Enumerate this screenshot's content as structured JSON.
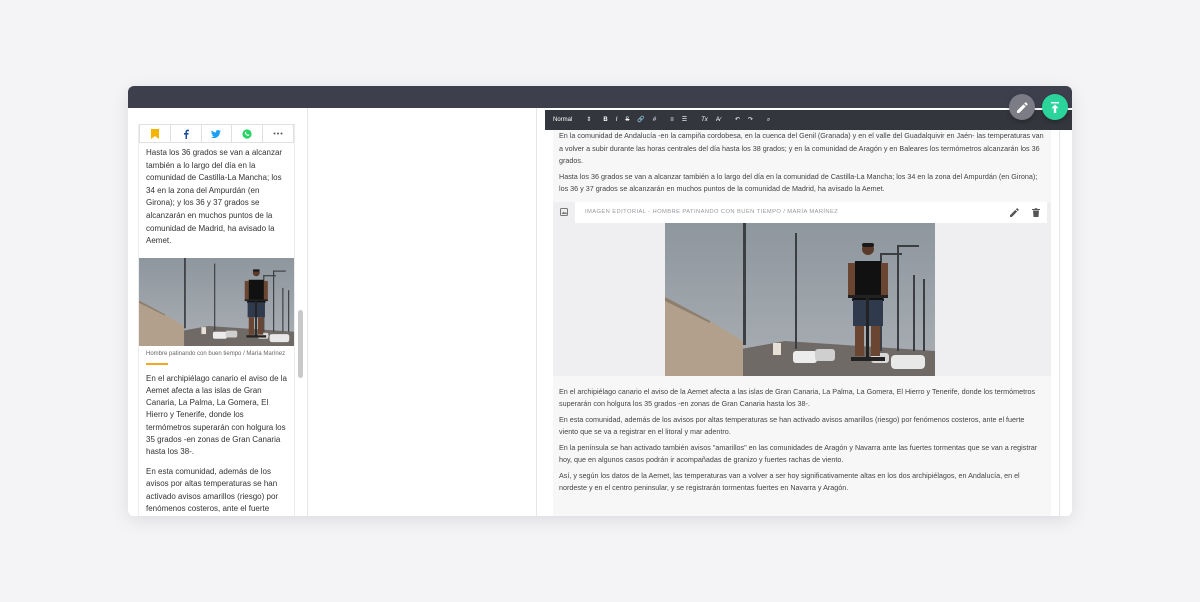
{
  "mobile_preview": {
    "share_icons": [
      "bookmark-icon",
      "facebook-icon",
      "twitter-icon",
      "whatsapp-icon",
      "more-icon"
    ],
    "paragraph_1": "Hasta los 36 grados se van a alcanzar también a lo largo del día en la comunidad de Castilla-La Mancha; los 34 en la zona del Ampurdán (en Girona); y los 36 y 37 grados se alcanzarán en muchos puntos de la comunidad de Madrid, ha avisado la Aemet.",
    "caption": "Hombre patinando con buen tiempo / María Marínez",
    "paragraph_2": "En el archipiélago canario el aviso de la Aemet afecta a las islas de Gran Canaria, La Palma, La Gomera, El Hierro y Tenerife, donde los termómetros superarán con holgura los 35 grados -en zonas de Gran Canaria hasta los 38-.",
    "paragraph_3": "En esta comunidad, además de los avisos por altas temperaturas se han activado avisos amarillos (riesgo) por fenómenos costeros, ante el fuerte viento que se va a registrar en el litoral y mar adentro."
  },
  "toolbar": {
    "format_select": "Normal",
    "format_arrow": "⇕",
    "bold": "B",
    "italic": "I",
    "strike": "S",
    "link": "🔗",
    "hash": "#",
    "ordered_list": "≡",
    "bullet_list": "☰",
    "clear_format": "Tx",
    "spellcheck": "A∕",
    "undo": "↶",
    "redo": "↷",
    "search": "⌕"
  },
  "editor": {
    "p1": "En la comunidad de Andalucía -en la campiña cordobesa, en la cuenca del Genil (Granada) y en el valle del Guadalquivir en Jaén- las temperaturas van a volver a subir durante las horas centrales del día hasta los 38 grados; y en la comunidad de Aragón y en Baleares los termómetros alcanzarán los 36 grados.",
    "p2": "Hasta los 36 grados se van a alcanzar también a lo largo del día en la comunidad de Castilla-La Mancha; los 34 en la zona del Ampurdán (en Girona); los 36 y 37 grados se alcanzarán en muchos puntos de la comunidad de Madrid, ha avisado la Aemet.",
    "image_title": "IMAGEN EDITORIAL - HOMBRE PATINANDO CON BUEN TIEMPO / MARÍA MARÍNEZ",
    "p3": "En el archipiélago canario el aviso de la Aemet afecta a las islas de Gran Canaria, La Palma, La Gomera, El Hierro y Tenerife, donde los termómetros superarán con holgura los 35 grados -en zonas de Gran Canaria hasta los 38-.",
    "p4": "En esta comunidad, además de los avisos por altas temperaturas se han activado avisos amarillos (riesgo) por fenómenos costeros, ante el fuerte viento que se va a registrar en el litoral y mar adentro.",
    "p5": "En la península se han activado también avisos \"amarillos\" en las comunidades de Aragón y Navarra ante las fuertes tormentas que se van a registrar hoy, que en algunos casos podrán ir acompañadas de granizo y fuertes rachas de viento.",
    "p6": "Así, y según los datos de la Aemet, las temperaturas van a volver a ser hoy significativamente altas en los dos archipiélagos, en Andalucía, en el nordeste y en el centro peninsular, y se registrarán tormentas fuertes en Navarra y Aragón."
  },
  "fabs": [
    "pencil-icon",
    "publish-icon"
  ],
  "colors": {
    "titlebar": "#3d3f4d",
    "toolbar": "#34363d",
    "accent_publish": "#2bd49b",
    "edit_fab": "#7b7c85",
    "caption_rule": "#f5a623"
  }
}
